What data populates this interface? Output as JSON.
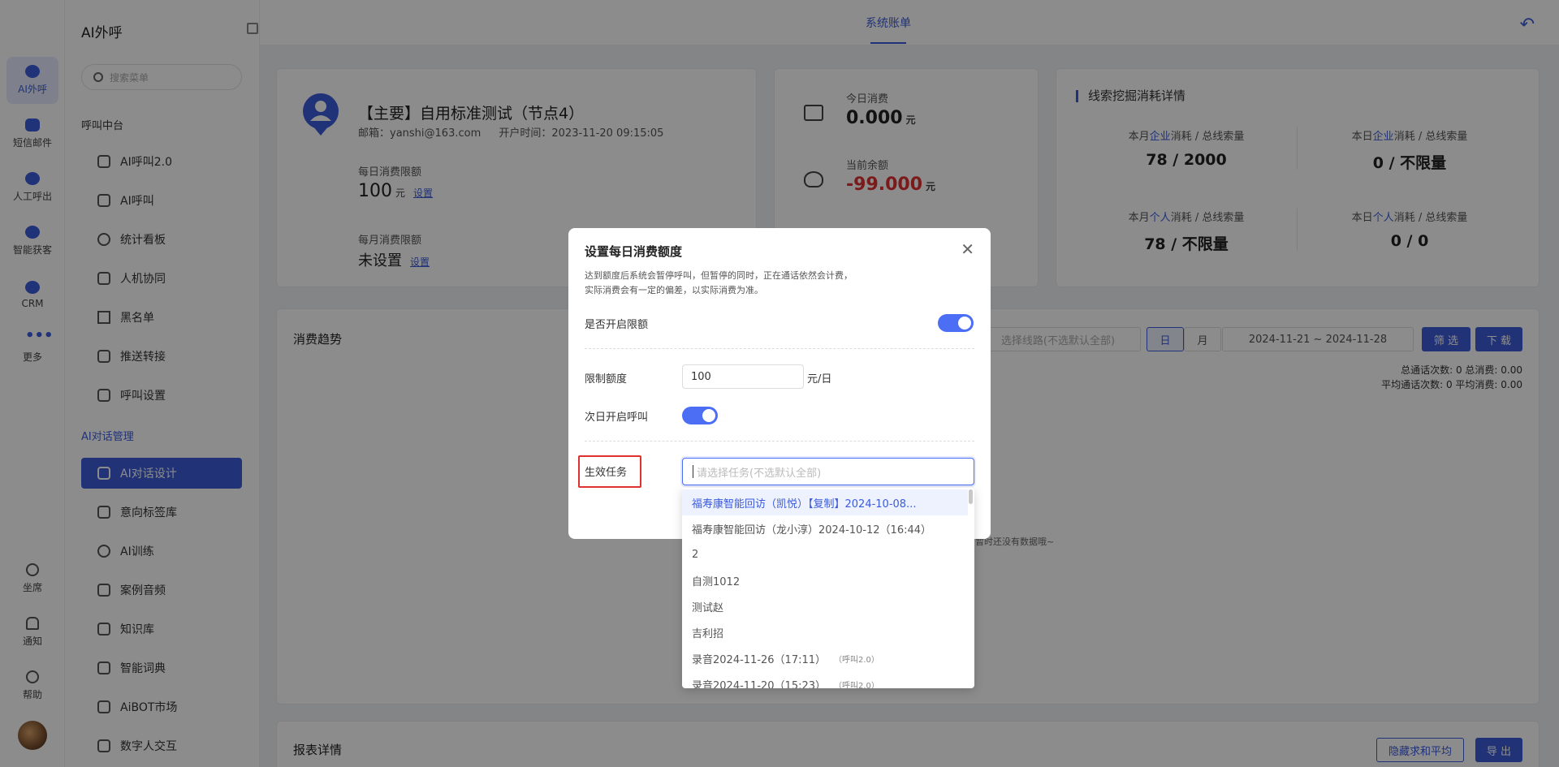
{
  "rail": {
    "items": [
      {
        "label": "AI外呼",
        "icon": "robot-icon"
      },
      {
        "label": "短信邮件",
        "icon": "message-icon"
      },
      {
        "label": "人工呼出",
        "icon": "headset-icon"
      },
      {
        "label": "智能获客",
        "icon": "target-icon"
      },
      {
        "label": "CRM",
        "icon": "crm-icon"
      },
      {
        "label": "更多",
        "icon": "more-icon"
      }
    ],
    "bottom": [
      {
        "label": "坐席",
        "icon": "agent-icon"
      },
      {
        "label": "通知",
        "icon": "bell-icon"
      },
      {
        "label": "帮助",
        "icon": "help-icon"
      }
    ]
  },
  "sidebar": {
    "title": "AI外呼",
    "search_placeholder": "搜索菜单",
    "group1": "呼叫中台",
    "items1": [
      "AI呼叫2.0",
      "AI呼叫",
      "统计看板",
      "人机协同",
      "黑名单",
      "推送转接",
      "呼叫设置"
    ],
    "group2": "AI对话管理",
    "items2": [
      "AI对话设计",
      "意向标签库",
      "AI训练",
      "案例音频",
      "知识库",
      "智能词典",
      "AiBOT市场",
      "数字人交互"
    ]
  },
  "topbar": {
    "tab": "系统账单"
  },
  "account": {
    "title": "【主要】自用标准测试（节点4）",
    "email": "邮箱：yanshi@163.com",
    "open_time": "开户时间：2023-11-20 09:15:05",
    "daily_label": "每日消费限额",
    "daily_value": "100",
    "daily_unit": "元",
    "daily_link": "设置",
    "monthly_label": "每月消费限额",
    "monthly_value": "未设置",
    "monthly_link": "设置"
  },
  "fees": {
    "today_label": "今日消费",
    "today_value": "0.000",
    "today_unit": "元",
    "balance_label": "当前余额",
    "balance_value": "-99.000",
    "balance_unit": "元"
  },
  "mining": {
    "title": "线索挖掘消耗详情",
    "stats": [
      {
        "pre": "本月",
        "key": "企业",
        "post": "消耗 / 总线索量",
        "value": "78 / 2000"
      },
      {
        "pre": "本日",
        "key": "企业",
        "post": "消耗 / 总线索量",
        "value": "0 / 不限量"
      },
      {
        "pre": "本月",
        "key": "个人",
        "post": "消耗 / 总线索量",
        "value": "78 / 不限量"
      },
      {
        "pre": "本日",
        "key": "个人",
        "post": "消耗 / 总线索量",
        "value": "0 / 0"
      }
    ]
  },
  "trend": {
    "title": "消费趋势",
    "line_placeholder": "选择线路(不选默认全部)",
    "day": "日",
    "month": "月",
    "date_range": "2024-11-21  ~  2024-11-28",
    "filter": "筛 选",
    "download": "下 载",
    "sum1": "总通话次数:  0    总消费:  0.00",
    "sum2": "平均通话次数:  0     平均消费:  0.00",
    "empty": "暂时还没有数据哦~"
  },
  "report": {
    "title": "报表详情",
    "hide_btn": "隐藏求和平均",
    "export_btn": "导 出"
  },
  "modal": {
    "title": "设置每日消费额度",
    "desc1": "达到额度后系统会暂停呼叫，但暂停的同时，正在通话依然会计费，",
    "desc2": "实际消费会有一定的偏差，以实际消费为准。",
    "enable_label": "是否开启限额",
    "limit_label": "限制额度",
    "limit_value": "100",
    "limit_unit": "元/日",
    "next_day_label": "次日开启呼叫",
    "task_label": "生效任务",
    "task_placeholder": "请选择任务(不选默认全部)"
  },
  "dropdown": {
    "items": [
      {
        "text": "福寿康智能回访（凯悦）【复制】2024-10-08...",
        "tag": ""
      },
      {
        "text": "福寿康智能回访（龙小淳）2024-10-12（16:44）",
        "tag": ""
      },
      {
        "text": "2",
        "tag": ""
      },
      {
        "text": "自测1012",
        "tag": ""
      },
      {
        "text": "测试赵",
        "tag": ""
      },
      {
        "text": "吉利招",
        "tag": ""
      },
      {
        "text": "录音2024-11-26（17:11）",
        "tag": "（呼叫2.0）"
      },
      {
        "text": "录音2024-11-20（15:23）",
        "tag": "（呼叫2.0）"
      }
    ]
  }
}
